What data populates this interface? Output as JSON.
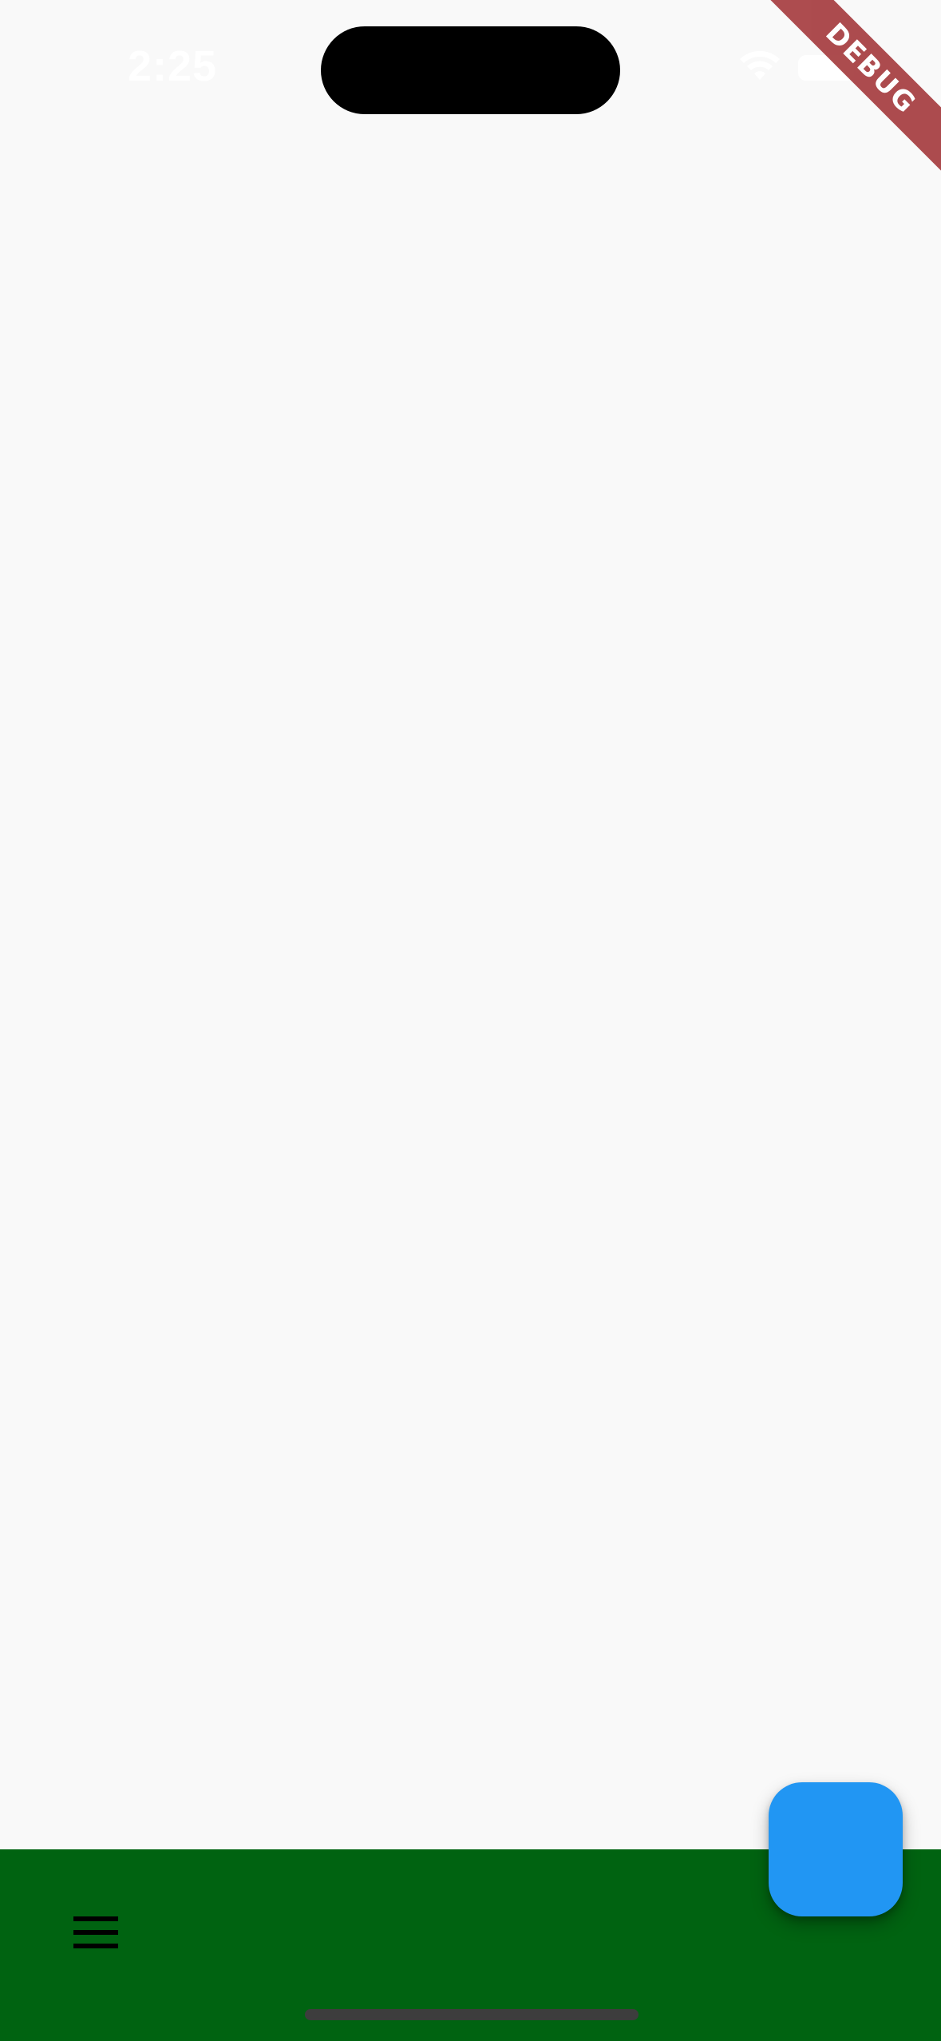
{
  "status_bar": {
    "time": "2:25",
    "wifi_icon": "wifi-icon",
    "battery_icon": "battery-icon"
  },
  "debug_banner": {
    "label": "DEBUG",
    "color": "#a63d40"
  },
  "bottom_app_bar": {
    "color": "#006311",
    "menu_icon": "menu-icon"
  },
  "fab": {
    "color": "#2196f3"
  },
  "background_color": "#f9f9f9"
}
